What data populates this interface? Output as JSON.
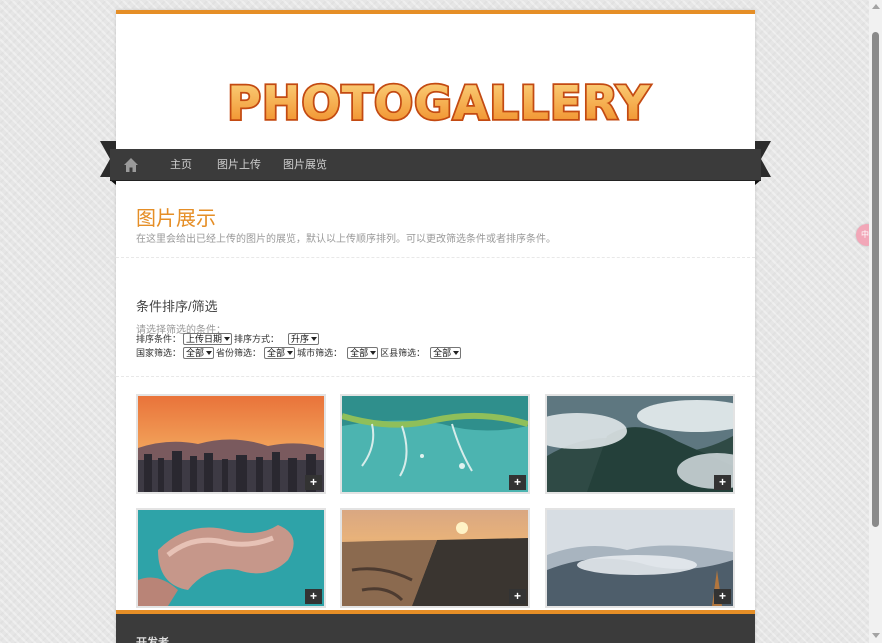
{
  "logo_text": "PHOTOGALLERY",
  "nav": {
    "home_icon": "home-icon",
    "items": [
      {
        "label": "主页"
      },
      {
        "label": "图片上传"
      },
      {
        "label": "图片展览"
      }
    ]
  },
  "header": {
    "title": "图片展示",
    "description": "在这里会给出已经上传的图片的展览，默认以上传顺序排列。可以更改筛选条件或者排序条件。"
  },
  "filters": {
    "section_title": "条件排序/筛选",
    "hint": "请选择筛选的条件：",
    "sort_by_label": "排序条件：",
    "sort_by_value": "上传日期",
    "sort_order_label": "排序方式：",
    "sort_order_value": "升序",
    "country_label": "国家筛选：",
    "country_value": "全部",
    "province_label": "省份筛选：",
    "province_value": "全部",
    "city_label": "城市筛选：",
    "city_value": "全部",
    "district_label": "区县筛选：",
    "district_value": "全部"
  },
  "gallery": {
    "expand_symbol": "+",
    "items": [
      {
        "scene": "sunset-city-skyline"
      },
      {
        "scene": "aerial-wetland-teal"
      },
      {
        "scene": "clouds-over-forest-mountains"
      },
      {
        "scene": "aerial-island-village"
      },
      {
        "scene": "coastal-sunset-road"
      },
      {
        "scene": "foggy-mountain-ridges"
      }
    ]
  },
  "footer": {
    "title": "开发者"
  },
  "side_badge": "中",
  "colors": {
    "accent": "#e58e26",
    "nav_bg": "#3b3b3b"
  }
}
